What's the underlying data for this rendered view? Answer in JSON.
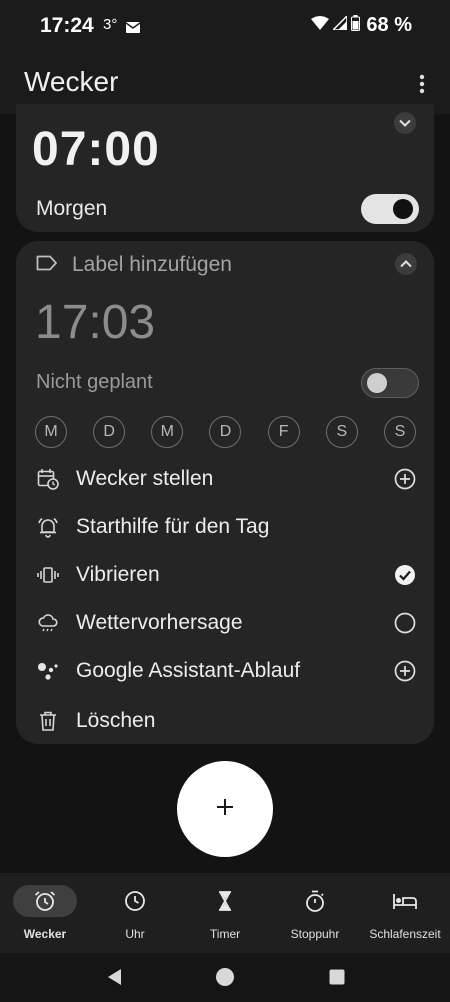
{
  "status_bar": {
    "time": "17:24",
    "temperature": "3°",
    "battery": "68 %",
    "icons": [
      "mail-icon",
      "wifi-icon",
      "signal-icon",
      "battery-icon"
    ]
  },
  "app_bar": {
    "title": "Wecker",
    "more_icon": "more-vert-icon"
  },
  "alarms": [
    {
      "time": "07:00",
      "label": "Morgen",
      "enabled": true,
      "expanded": false
    },
    {
      "label_placeholder": "Label hinzufügen",
      "time": "17:03",
      "schedule": "Nicht geplant",
      "enabled": false,
      "expanded": true,
      "days": [
        "M",
        "D",
        "M",
        "D",
        "F",
        "S",
        "S"
      ],
      "options": [
        {
          "label": "Wecker stellen",
          "icon": "calendar-clock-icon",
          "trailing": "add-circle-icon"
        },
        {
          "label": "Starthilfe für den Tag",
          "icon": "alarm-bell-icon",
          "trailing": ""
        },
        {
          "label": "Vibrieren",
          "icon": "vibrate-icon",
          "trailing": "check-circle-icon"
        },
        {
          "label": "Wettervorhersage",
          "icon": "weather-icon",
          "trailing": "empty-circle-icon"
        },
        {
          "label": "Google Assistant-Ablauf",
          "icon": "assistant-icon",
          "trailing": "add-circle-icon"
        },
        {
          "label": "Löschen",
          "icon": "trash-icon",
          "trailing": ""
        }
      ]
    }
  ],
  "fab": {
    "icon": "plus-icon"
  },
  "bottom_nav": [
    {
      "label": "Wecker",
      "icon": "alarm-clock-icon",
      "active": true
    },
    {
      "label": "Uhr",
      "icon": "clock-icon",
      "active": false
    },
    {
      "label": "Timer",
      "icon": "hourglass-icon",
      "active": false
    },
    {
      "label": "Stoppuhr",
      "icon": "stopwatch-icon",
      "active": false
    },
    {
      "label": "Schlafenszeit",
      "icon": "bed-icon",
      "active": false
    }
  ],
  "colors": {
    "background": "#131313",
    "card": "#252525",
    "fab": "#ffffff",
    "nav_active_pill": "#3f3f3f"
  }
}
